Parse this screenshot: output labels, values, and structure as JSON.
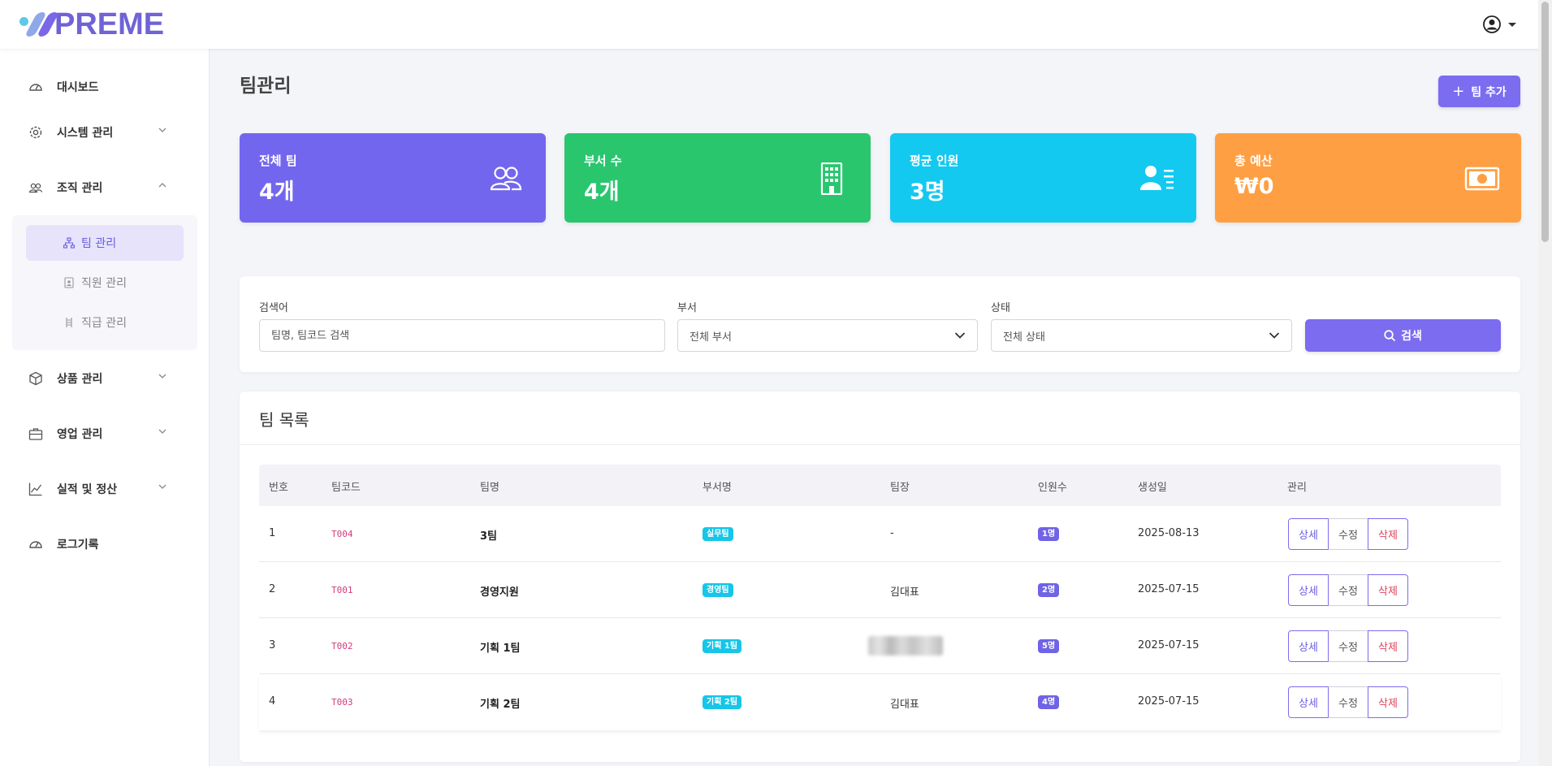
{
  "header": {
    "logo_text": "PREME",
    "user_icon": "user-circle-icon"
  },
  "sidebar": {
    "items": [
      {
        "label": "대시보드",
        "icon": "speedometer-icon"
      },
      {
        "label": "시스템 관리",
        "icon": "gear-icon"
      },
      {
        "label": "조직 관리",
        "icon": "people-icon"
      },
      {
        "label": "상품 관리",
        "icon": "box-icon"
      },
      {
        "label": "영업 관리",
        "icon": "briefcase-icon"
      },
      {
        "label": "실적 및 정산",
        "icon": "graph-icon"
      },
      {
        "label": "로그기록",
        "icon": "speedometer-icon"
      }
    ],
    "submenu": [
      {
        "label": "팀 관리",
        "icon": "diagram-icon",
        "active": true
      },
      {
        "label": "직원 관리",
        "icon": "person-badge-icon",
        "active": false
      },
      {
        "label": "직급 관리",
        "icon": "ladder-icon",
        "active": false
      }
    ]
  },
  "page": {
    "title": "팀관리",
    "add_button": "팀 추가"
  },
  "stats": [
    {
      "label": "전체 팀",
      "value": "4개",
      "color": "#7366ee",
      "icon": "people-icon"
    },
    {
      "label": "부서 수",
      "value": "4개",
      "color": "#29c66e",
      "icon": "building-icon"
    },
    {
      "label": "평균 인원",
      "value": "3명",
      "color": "#13c9f0",
      "icon": "person-lines-icon"
    },
    {
      "label": "총 예산",
      "value": "₩0",
      "color": "#ff9f43",
      "icon": "cash-icon"
    }
  ],
  "filters": {
    "keyword_label": "검색어",
    "keyword_placeholder": "팀명, 팀코드 검색",
    "dept_label": "부서",
    "dept_value": "전체 부서",
    "status_label": "상태",
    "status_value": "전체 상태",
    "search_button": "검색"
  },
  "list": {
    "title": "팀 목록",
    "headers": [
      "번호",
      "팀코드",
      "팀명",
      "부서명",
      "팀장",
      "인원수",
      "생성일",
      "관리"
    ],
    "rows": [
      {
        "no": "1",
        "code": "T004",
        "name": "3팀",
        "dept": "실무팀",
        "leader": "-",
        "count": "1명",
        "created": "2025-08-13"
      },
      {
        "no": "2",
        "code": "T001",
        "name": "경영지원",
        "dept": "경영팀",
        "leader": "김대표",
        "count": "2명",
        "created": "2025-07-15"
      },
      {
        "no": "3",
        "code": "T002",
        "name": "기획 1팀",
        "dept": "기획 1팀",
        "leader": "",
        "count": "5명",
        "created": "2025-07-15"
      },
      {
        "no": "4",
        "code": "T003",
        "name": "기획 2팀",
        "dept": "기획 2팀",
        "leader": "김대표",
        "count": "4명",
        "created": "2025-07-15"
      }
    ],
    "actions": {
      "detail": "상세",
      "edit": "수정",
      "delete": "삭제"
    }
  }
}
